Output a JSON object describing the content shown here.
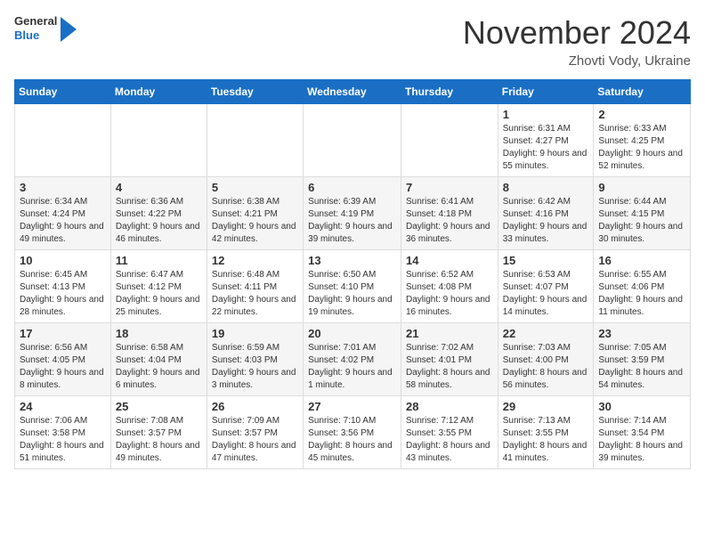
{
  "header": {
    "logo": {
      "general": "General",
      "blue": "Blue"
    },
    "title": "November 2024",
    "location": "Zhovti Vody, Ukraine"
  },
  "calendar": {
    "days_of_week": [
      "Sunday",
      "Monday",
      "Tuesday",
      "Wednesday",
      "Thursday",
      "Friday",
      "Saturday"
    ],
    "weeks": [
      [
        {
          "day": "",
          "info": ""
        },
        {
          "day": "",
          "info": ""
        },
        {
          "day": "",
          "info": ""
        },
        {
          "day": "",
          "info": ""
        },
        {
          "day": "",
          "info": ""
        },
        {
          "day": "1",
          "info": "Sunrise: 6:31 AM\nSunset: 4:27 PM\nDaylight: 9 hours and 55 minutes."
        },
        {
          "day": "2",
          "info": "Sunrise: 6:33 AM\nSunset: 4:25 PM\nDaylight: 9 hours and 52 minutes."
        }
      ],
      [
        {
          "day": "3",
          "info": "Sunrise: 6:34 AM\nSunset: 4:24 PM\nDaylight: 9 hours and 49 minutes."
        },
        {
          "day": "4",
          "info": "Sunrise: 6:36 AM\nSunset: 4:22 PM\nDaylight: 9 hours and 46 minutes."
        },
        {
          "day": "5",
          "info": "Sunrise: 6:38 AM\nSunset: 4:21 PM\nDaylight: 9 hours and 42 minutes."
        },
        {
          "day": "6",
          "info": "Sunrise: 6:39 AM\nSunset: 4:19 PM\nDaylight: 9 hours and 39 minutes."
        },
        {
          "day": "7",
          "info": "Sunrise: 6:41 AM\nSunset: 4:18 PM\nDaylight: 9 hours and 36 minutes."
        },
        {
          "day": "8",
          "info": "Sunrise: 6:42 AM\nSunset: 4:16 PM\nDaylight: 9 hours and 33 minutes."
        },
        {
          "day": "9",
          "info": "Sunrise: 6:44 AM\nSunset: 4:15 PM\nDaylight: 9 hours and 30 minutes."
        }
      ],
      [
        {
          "day": "10",
          "info": "Sunrise: 6:45 AM\nSunset: 4:13 PM\nDaylight: 9 hours and 28 minutes."
        },
        {
          "day": "11",
          "info": "Sunrise: 6:47 AM\nSunset: 4:12 PM\nDaylight: 9 hours and 25 minutes."
        },
        {
          "day": "12",
          "info": "Sunrise: 6:48 AM\nSunset: 4:11 PM\nDaylight: 9 hours and 22 minutes."
        },
        {
          "day": "13",
          "info": "Sunrise: 6:50 AM\nSunset: 4:10 PM\nDaylight: 9 hours and 19 minutes."
        },
        {
          "day": "14",
          "info": "Sunrise: 6:52 AM\nSunset: 4:08 PM\nDaylight: 9 hours and 16 minutes."
        },
        {
          "day": "15",
          "info": "Sunrise: 6:53 AM\nSunset: 4:07 PM\nDaylight: 9 hours and 14 minutes."
        },
        {
          "day": "16",
          "info": "Sunrise: 6:55 AM\nSunset: 4:06 PM\nDaylight: 9 hours and 11 minutes."
        }
      ],
      [
        {
          "day": "17",
          "info": "Sunrise: 6:56 AM\nSunset: 4:05 PM\nDaylight: 9 hours and 8 minutes."
        },
        {
          "day": "18",
          "info": "Sunrise: 6:58 AM\nSunset: 4:04 PM\nDaylight: 9 hours and 6 minutes."
        },
        {
          "day": "19",
          "info": "Sunrise: 6:59 AM\nSunset: 4:03 PM\nDaylight: 9 hours and 3 minutes."
        },
        {
          "day": "20",
          "info": "Sunrise: 7:01 AM\nSunset: 4:02 PM\nDaylight: 9 hours and 1 minute."
        },
        {
          "day": "21",
          "info": "Sunrise: 7:02 AM\nSunset: 4:01 PM\nDaylight: 8 hours and 58 minutes."
        },
        {
          "day": "22",
          "info": "Sunrise: 7:03 AM\nSunset: 4:00 PM\nDaylight: 8 hours and 56 minutes."
        },
        {
          "day": "23",
          "info": "Sunrise: 7:05 AM\nSunset: 3:59 PM\nDaylight: 8 hours and 54 minutes."
        }
      ],
      [
        {
          "day": "24",
          "info": "Sunrise: 7:06 AM\nSunset: 3:58 PM\nDaylight: 8 hours and 51 minutes."
        },
        {
          "day": "25",
          "info": "Sunrise: 7:08 AM\nSunset: 3:57 PM\nDaylight: 8 hours and 49 minutes."
        },
        {
          "day": "26",
          "info": "Sunrise: 7:09 AM\nSunset: 3:57 PM\nDaylight: 8 hours and 47 minutes."
        },
        {
          "day": "27",
          "info": "Sunrise: 7:10 AM\nSunset: 3:56 PM\nDaylight: 8 hours and 45 minutes."
        },
        {
          "day": "28",
          "info": "Sunrise: 7:12 AM\nSunset: 3:55 PM\nDaylight: 8 hours and 43 minutes."
        },
        {
          "day": "29",
          "info": "Sunrise: 7:13 AM\nSunset: 3:55 PM\nDaylight: 8 hours and 41 minutes."
        },
        {
          "day": "30",
          "info": "Sunrise: 7:14 AM\nSunset: 3:54 PM\nDaylight: 8 hours and 39 minutes."
        }
      ]
    ]
  }
}
